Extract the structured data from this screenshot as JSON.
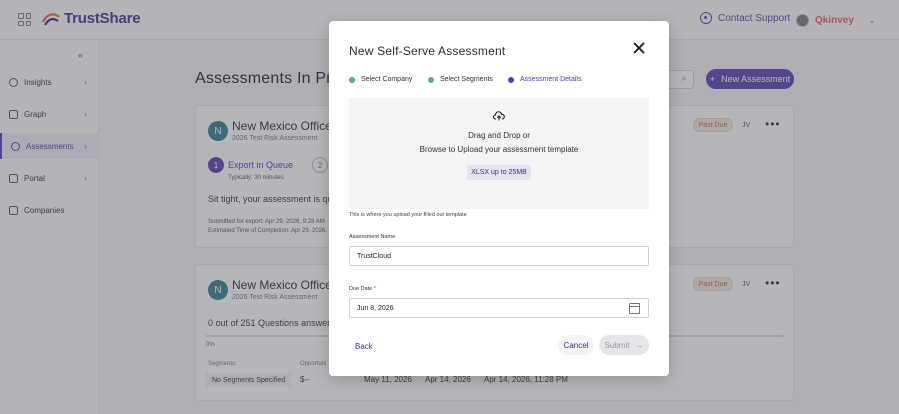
{
  "topbar": {
    "logo_text": "TrustShare",
    "support_label": "Contact Support",
    "brand2": "Qkinvey"
  },
  "sidebar": {
    "items": [
      {
        "label": "Insights"
      },
      {
        "label": "Graph"
      },
      {
        "label": "Assessments"
      },
      {
        "label": "Portal"
      },
      {
        "label": "Companies"
      }
    ]
  },
  "main": {
    "title": "Assessments In Progress",
    "new_button": "New Assessment",
    "cards": [
      {
        "avatar": "N",
        "title": "New Mexico Office of",
        "subtitle": "2026 Test Risk Assessment",
        "status": "Past Due",
        "owner": "JV",
        "step1_label": "Export in Queue",
        "step1_num": "1",
        "step2_num": "2",
        "typically": "Typically: 30 minutes",
        "message": "Sit tight, your assessment is qu",
        "submitted": "Submitted for export: Apr 29, 2026, 9:28 AM",
        "estimated": "Estimated Time of Completion: Apr 29, 2026, 1"
      },
      {
        "avatar": "N",
        "title": "New Mexico Office of",
        "subtitle": "2026 Test Risk Assessment",
        "status": "Past Due",
        "owner": "JV",
        "answered": "0 out of 251 Questions answered",
        "percent": "0%",
        "segments_label": "Segments:",
        "segments_value": "No Segments Specified",
        "opportunity_label": "Opportuni",
        "opportunity_value": "$--",
        "date1": "May 11, 2026",
        "date2": "Apr 14, 2026",
        "date3": "Apr 14, 2026, 11:28 PM"
      }
    ]
  },
  "modal": {
    "title": "New Self-Serve Assessment",
    "steps": [
      {
        "label": "Select Company",
        "state": "done"
      },
      {
        "label": "Select Segments",
        "state": "done"
      },
      {
        "label": "Assessment Details",
        "state": "current"
      }
    ],
    "dropzone": {
      "line1": "Drag and Drop or",
      "line2": "Browse to Upload your assessment template",
      "badge": "XLSX up to 25MB"
    },
    "helper": "This is where you upload your filled out template",
    "name_label": "Assessment Name",
    "name_value": "TrustCloud",
    "due_label": "Due Date",
    "due_required": "*",
    "due_value": "Jun 8, 2026",
    "back": "Back",
    "cancel": "Cancel",
    "submit": "Submit"
  },
  "colors": {
    "accent": "#5a3bb0",
    "done_step": "#5aa89a",
    "past_due": "#c86c4b"
  }
}
